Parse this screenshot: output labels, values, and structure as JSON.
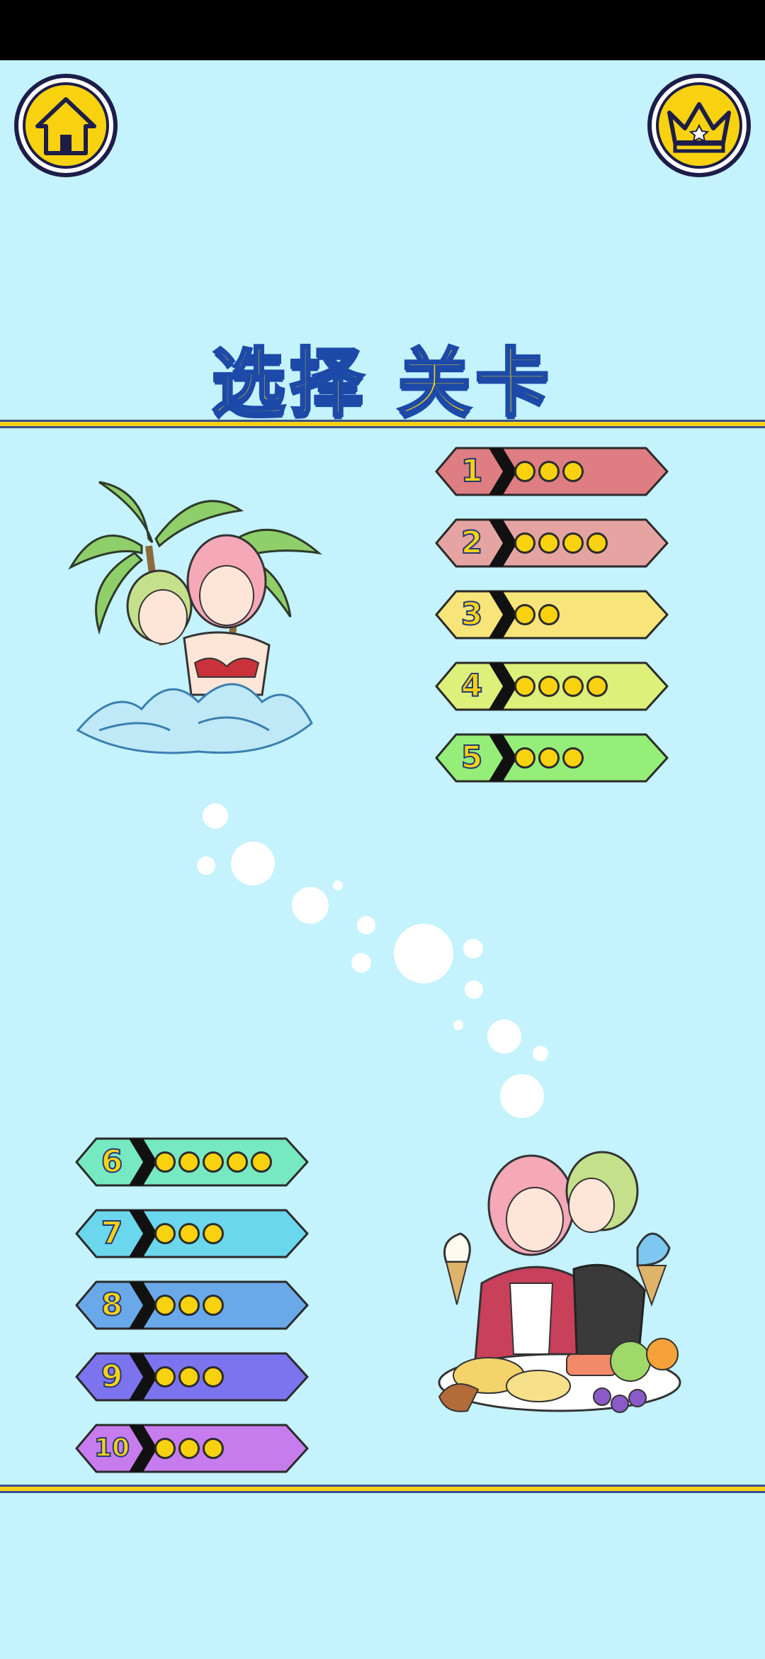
{
  "title": "选择 关卡",
  "icons": {
    "home": "home-icon",
    "crown": "crown-icon"
  },
  "levels": [
    {
      "number": "1",
      "dots": 3,
      "color": "#de7d82"
    },
    {
      "number": "2",
      "dots": 4,
      "color": "#e5a4a2"
    },
    {
      "number": "3",
      "dots": 2,
      "color": "#f7e57a"
    },
    {
      "number": "4",
      "dots": 4,
      "color": "#dcf07a"
    },
    {
      "number": "5",
      "dots": 3,
      "color": "#95ee78"
    },
    {
      "number": "6",
      "dots": 5,
      "color": "#76e8c2"
    },
    {
      "number": "7",
      "dots": 3,
      "color": "#6ad7ec"
    },
    {
      "number": "8",
      "dots": 3,
      "color": "#6aa9e9"
    },
    {
      "number": "9",
      "dots": 3,
      "color": "#7c73ef"
    },
    {
      "number": "10",
      "dots": 3,
      "color": "#c77cee"
    }
  ],
  "colors": {
    "background": "#c4f2fd",
    "accent": "#f7d116",
    "outline": "#1d4aa8"
  }
}
